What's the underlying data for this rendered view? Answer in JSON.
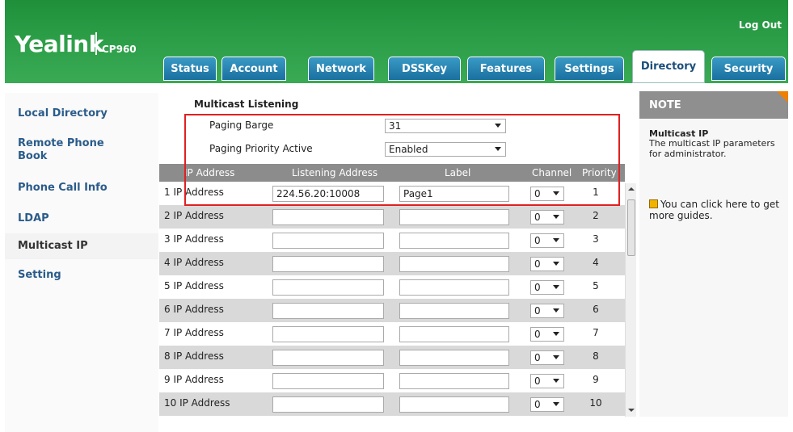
{
  "header": {
    "logo": "Yealink",
    "model": "CP960",
    "logout": "Log Out"
  },
  "tabs": [
    {
      "label": "Status"
    },
    {
      "label": "Account"
    },
    {
      "label": "Network"
    },
    {
      "label": "DSSKey"
    },
    {
      "label": "Features"
    },
    {
      "label": "Settings"
    },
    {
      "label": "Directory",
      "active": true
    },
    {
      "label": "Security"
    }
  ],
  "sidebar": {
    "items": [
      {
        "label": "Local Directory"
      },
      {
        "label": "Remote Phone Book"
      },
      {
        "label": "Phone Call Info"
      },
      {
        "label": "LDAP"
      },
      {
        "label": "Multicast IP",
        "active": true
      },
      {
        "label": "Setting"
      }
    ]
  },
  "main": {
    "section_title": "Multicast Listening",
    "paging_barge_label": "Paging Barge",
    "paging_barge_value": "31",
    "paging_priority_label": "Paging Priority Active",
    "paging_priority_value": "Enabled",
    "columns": [
      "IP Address",
      "Listening Address",
      "Label",
      "Channel",
      "Priority"
    ],
    "rows": [
      {
        "name": "1 IP Address",
        "address": "224.56.20:10008",
        "label": "Page1",
        "channel": "0",
        "priority": "1"
      },
      {
        "name": "2 IP Address",
        "address": "",
        "label": "",
        "channel": "0",
        "priority": "2"
      },
      {
        "name": "3 IP Address",
        "address": "",
        "label": "",
        "channel": "0",
        "priority": "3"
      },
      {
        "name": "4 IP Address",
        "address": "",
        "label": "",
        "channel": "0",
        "priority": "4"
      },
      {
        "name": "5 IP Address",
        "address": "",
        "label": "",
        "channel": "0",
        "priority": "5"
      },
      {
        "name": "6 IP Address",
        "address": "",
        "label": "",
        "channel": "0",
        "priority": "6"
      },
      {
        "name": "7 IP Address",
        "address": "",
        "label": "",
        "channel": "0",
        "priority": "7"
      },
      {
        "name": "8 IP Address",
        "address": "",
        "label": "",
        "channel": "0",
        "priority": "8"
      },
      {
        "name": "9 IP Address",
        "address": "",
        "label": "",
        "channel": "0",
        "priority": "9"
      },
      {
        "name": "10 IP Address",
        "address": "",
        "label": "",
        "channel": "0",
        "priority": "10"
      }
    ]
  },
  "note": {
    "header": "NOTE",
    "title": "Multicast IP",
    "text": "The multicast IP parameters for administrator.",
    "guide": "You can click here to get more guides."
  },
  "colors": {
    "header_green": "#2a9c46",
    "tab_blue": "#1a6fa0",
    "link_blue": "#2b5c8a",
    "highlight_red": "#e02020",
    "note_corner": "#f08000"
  }
}
